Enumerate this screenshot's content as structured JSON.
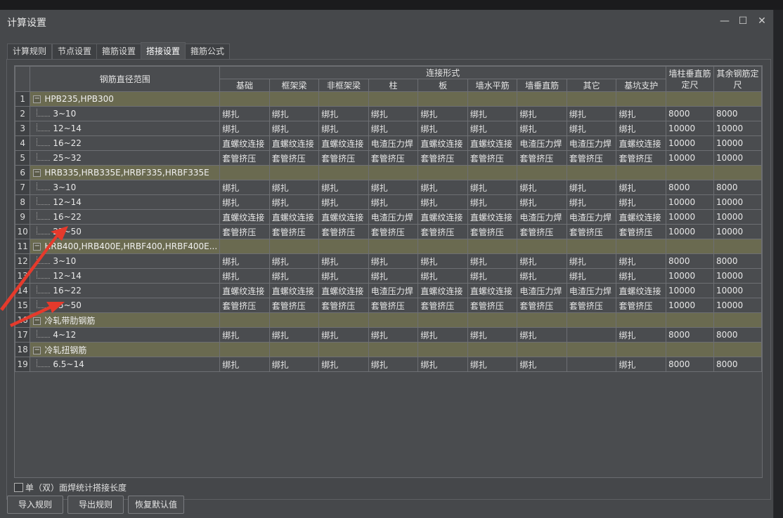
{
  "window": {
    "title": "计算设置",
    "min_glyph": "—",
    "max_glyph": "☐",
    "close_glyph": "✕"
  },
  "tabs": [
    {
      "label": "计算规则"
    },
    {
      "label": "节点设置"
    },
    {
      "label": "箍筋设置"
    },
    {
      "label": "搭接设置",
      "active": true
    },
    {
      "label": "箍筋公式"
    }
  ],
  "table": {
    "col_range": "钢筋直径范围",
    "col_group": "连接形式",
    "sub_columns": [
      "基础",
      "框架梁",
      "非框架梁",
      "柱",
      "板",
      "墙水平筋",
      "墙垂直筋",
      "其它",
      "基坑支护"
    ],
    "col_wall": "墙柱垂直筋定尺",
    "col_other": "其余钢筋定尺",
    "rows": [
      {
        "num": "1",
        "group": true,
        "name": "HPB235,HPB300"
      },
      {
        "num": "2",
        "name": "3~10",
        "cells": [
          "绑扎",
          "绑扎",
          "绑扎",
          "绑扎",
          "绑扎",
          "绑扎",
          "绑扎",
          "绑扎",
          "绑扎",
          "8000",
          "8000"
        ]
      },
      {
        "num": "3",
        "name": "12~14",
        "cells": [
          "绑扎",
          "绑扎",
          "绑扎",
          "绑扎",
          "绑扎",
          "绑扎",
          "绑扎",
          "绑扎",
          "绑扎",
          "10000",
          "10000"
        ]
      },
      {
        "num": "4",
        "name": "16~22",
        "cells": [
          "直螺纹连接",
          "直螺纹连接",
          "直螺纹连接",
          "电渣压力焊",
          "直螺纹连接",
          "直螺纹连接",
          "电渣压力焊",
          "电渣压力焊",
          "直螺纹连接",
          "10000",
          "10000"
        ]
      },
      {
        "num": "5",
        "name": "25~32",
        "cells": [
          "套管挤压",
          "套管挤压",
          "套管挤压",
          "套管挤压",
          "套管挤压",
          "套管挤压",
          "套管挤压",
          "套管挤压",
          "套管挤压",
          "10000",
          "10000"
        ]
      },
      {
        "num": "6",
        "group": true,
        "name": "HRB335,HRB335E,HRBF335,HRBF335E"
      },
      {
        "num": "7",
        "name": "3~10",
        "cells": [
          "绑扎",
          "绑扎",
          "绑扎",
          "绑扎",
          "绑扎",
          "绑扎",
          "绑扎",
          "绑扎",
          "绑扎",
          "8000",
          "8000"
        ]
      },
      {
        "num": "8",
        "name": "12~14",
        "cells": [
          "绑扎",
          "绑扎",
          "绑扎",
          "绑扎",
          "绑扎",
          "绑扎",
          "绑扎",
          "绑扎",
          "绑扎",
          "10000",
          "10000"
        ]
      },
      {
        "num": "9",
        "name": "16~22",
        "cells": [
          "直螺纹连接",
          "直螺纹连接",
          "直螺纹连接",
          "电渣压力焊",
          "直螺纹连接",
          "直螺纹连接",
          "电渣压力焊",
          "电渣压力焊",
          "直螺纹连接",
          "10000",
          "10000"
        ]
      },
      {
        "num": "10",
        "name": "25~50",
        "cells": [
          "套管挤压",
          "套管挤压",
          "套管挤压",
          "套管挤压",
          "套管挤压",
          "套管挤压",
          "套管挤压",
          "套管挤压",
          "套管挤压",
          "10000",
          "10000"
        ]
      },
      {
        "num": "11",
        "group": true,
        "name": "HRB400,HRB400E,HRBF400,HRBF400E..."
      },
      {
        "num": "12",
        "name": "3~10",
        "cells": [
          "绑扎",
          "绑扎",
          "绑扎",
          "绑扎",
          "绑扎",
          "绑扎",
          "绑扎",
          "绑扎",
          "绑扎",
          "8000",
          "8000"
        ]
      },
      {
        "num": "13",
        "name": "12~14",
        "cells": [
          "绑扎",
          "绑扎",
          "绑扎",
          "绑扎",
          "绑扎",
          "绑扎",
          "绑扎",
          "绑扎",
          "绑扎",
          "10000",
          "10000"
        ]
      },
      {
        "num": "14",
        "name": "16~22",
        "cells": [
          "直螺纹连接",
          "直螺纹连接",
          "直螺纹连接",
          "电渣压力焊",
          "直螺纹连接",
          "直螺纹连接",
          "电渣压力焊",
          "电渣压力焊",
          "直螺纹连接",
          "10000",
          "10000"
        ]
      },
      {
        "num": "15",
        "name": "25~50",
        "cells": [
          "套管挤压",
          "套管挤压",
          "套管挤压",
          "套管挤压",
          "套管挤压",
          "套管挤压",
          "套管挤压",
          "套管挤压",
          "套管挤压",
          "10000",
          "10000"
        ]
      },
      {
        "num": "16",
        "group": true,
        "name": "冷轧带肋钢筋"
      },
      {
        "num": "17",
        "name": "4~12",
        "cells": [
          "绑扎",
          "绑扎",
          "绑扎",
          "绑扎",
          "绑扎",
          "绑扎",
          "绑扎",
          "",
          "绑扎",
          "8000",
          "8000"
        ]
      },
      {
        "num": "18",
        "group": true,
        "name": "冷轧扭钢筋"
      },
      {
        "num": "19",
        "name": "6.5~14",
        "cells": [
          "绑扎",
          "绑扎",
          "绑扎",
          "绑扎",
          "绑扎",
          "绑扎",
          "绑扎",
          "",
          "绑扎",
          "8000",
          "8000"
        ]
      }
    ]
  },
  "options": {
    "single_double_label": "单（双）面焊统计搭接长度",
    "checked": false
  },
  "buttons": {
    "import": "导入规则",
    "export": "导出规则",
    "restore": "恢复默认值"
  },
  "colors": {
    "group_row": "#6a6a50",
    "window_bg": "#46484b",
    "annotation_arrow": "#e53a2c"
  }
}
